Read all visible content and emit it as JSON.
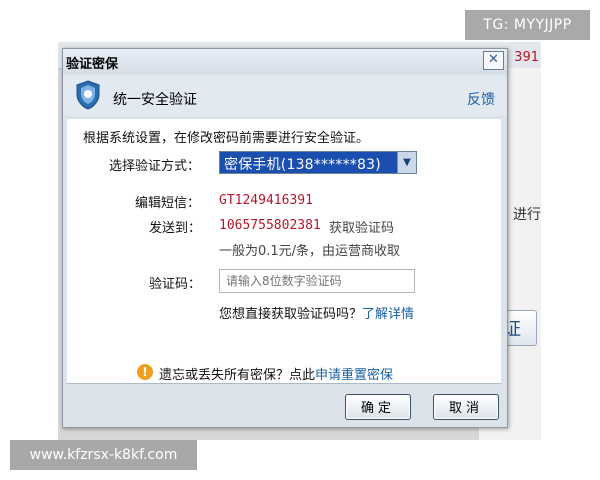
{
  "watermarks": {
    "top": "TG: MYYJJPP",
    "bottom": "www.kfzrsx-k8kf.com"
  },
  "background": {
    "number_fragment": "391",
    "text_fragment": "进行",
    "button_fragment": "证"
  },
  "dialog": {
    "title": "验证密保",
    "close_glyph": "✕",
    "header": {
      "title": "统一安全验证",
      "feedback": "反馈"
    },
    "intro": "根据系统设置，在修改密码前需要进行安全验证。",
    "method": {
      "label": "选择验证方式：",
      "selected": "密保手机(138******83)"
    },
    "sms": {
      "edit_label": "编辑短信：",
      "edit_value": "GT1249416391",
      "send_label": "发送到：",
      "send_value": "1065755802381",
      "get_code": "获取验证码",
      "fee_note": "一般为0.1元/条，由运营商收取"
    },
    "code": {
      "label": "验证码：",
      "placeholder": "请输入8位数字验证码"
    },
    "direct_question": "您想直接获取验证码吗？",
    "learn_more": "了解详情",
    "forgot_text": "遗忘或丢失所有密保？点此",
    "reset_link": "申请重置密保",
    "buttons": {
      "ok": "确定",
      "cancel": "取消"
    }
  },
  "colors": {
    "accent_link": "#1a5fa8",
    "value_red": "#b5172b",
    "select_highlight": "#1a4fb0",
    "warning": "#f0a020"
  },
  "icons": {
    "shield": "shield-icon",
    "warning": "info-warning-icon",
    "dropdown": "chevron-down-icon",
    "close": "close-icon"
  }
}
